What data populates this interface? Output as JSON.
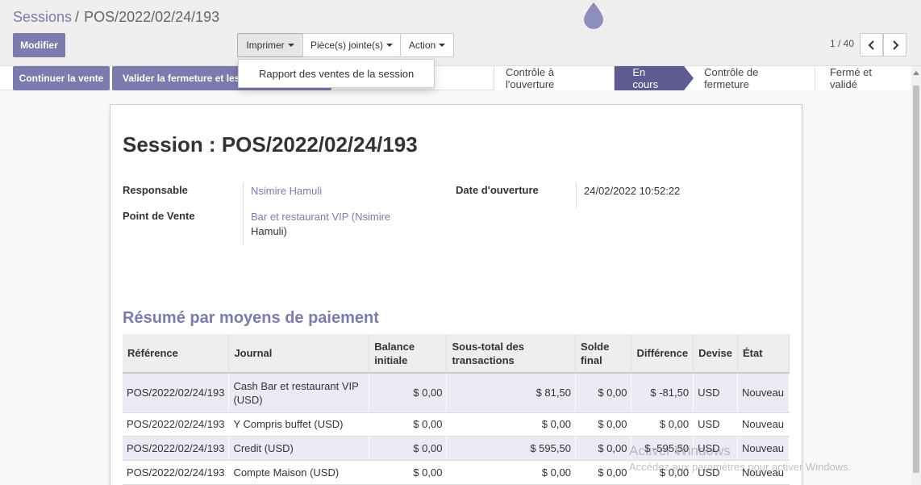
{
  "breadcrumb": {
    "parent": "Sessions",
    "separator": "/",
    "current": "POS/2022/02/24/193"
  },
  "toolbar": {
    "modifier": "Modifier",
    "imprimer": "Imprimer",
    "pieces_jointes": "Pièce(s) jointe(s)",
    "action": "Action"
  },
  "print_menu": {
    "item": "Rapport des ventes de la session"
  },
  "pager": {
    "value": "1 / 40"
  },
  "statusbar": {
    "continuer": "Continuer la vente",
    "valider": "Valider la fermeture et les é",
    "stages": [
      "Contrôle à l'ouverture",
      "En cours",
      "Contrôle de fermeture",
      "Fermé et validé"
    ],
    "active_stage": "En cours"
  },
  "session": {
    "title": "Session : POS/2022/02/24/193",
    "responsable_label": "Responsable",
    "responsable": "Nsimire Hamuli",
    "pdv_label": "Point de Vente",
    "pdv_line1": "Bar et restaurant VIP (Nsimire",
    "pdv_line2": "Hamuli)",
    "date_label": "Date d'ouverture",
    "date": "24/02/2022 10:52:22"
  },
  "payments": {
    "section_title": "Résumé par moyens de paiement",
    "headers": [
      "Référence",
      "Journal",
      "Balance initiale",
      "Sous-total des transactions",
      "Solde final",
      "Différence",
      "Devise",
      "État"
    ],
    "rows": [
      [
        "POS/2022/02/24/193",
        "Cash Bar et restaurant VIP (USD)",
        "$ 0,00",
        "$ 81,50",
        "$ 0,00",
        "$ -81,50",
        "USD",
        "Nouveau"
      ],
      [
        "POS/2022/02/24/193",
        "Y Compris buffet (USD)",
        "$ 0,00",
        "$ 0,00",
        "$ 0,00",
        "$ 0,00",
        "USD",
        "Nouveau"
      ],
      [
        "POS/2022/02/24/193",
        "Credit (USD)",
        "$ 0,00",
        "$ 595,50",
        "$ 0,00",
        "$ -595,50",
        "USD",
        "Nouveau"
      ],
      [
        "POS/2022/02/24/193",
        "Compte Maison (USD)",
        "$ 0,00",
        "$ 0,00",
        "$ 0,00",
        "$ 0,00",
        "USD",
        "Nouveau"
      ]
    ]
  },
  "watermark": {
    "title": "Activer Windows",
    "subtitle": "Accédez aux paramètres pour activer Windows."
  },
  "colors": {
    "brand": "#7c7bad",
    "active_stage": "#5d5b8f"
  },
  "icons": [
    "droplet-logo-icon",
    "caret-down-icon",
    "chevron-left-icon",
    "chevron-right-icon"
  ]
}
